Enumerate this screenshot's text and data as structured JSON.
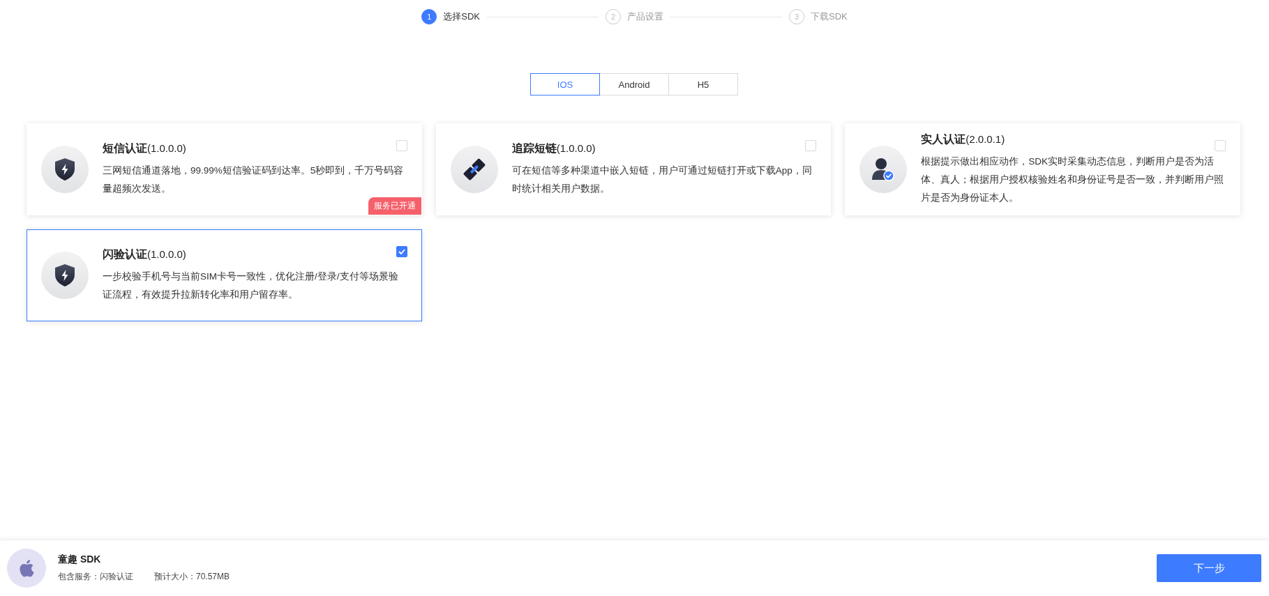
{
  "steps": [
    {
      "number": "1",
      "label": "选择SDK",
      "selected": true
    },
    {
      "number": "2",
      "label": "产品设置",
      "selected": false
    },
    {
      "number": "3",
      "label": "下载SDK",
      "selected": false
    }
  ],
  "platform_tabs": [
    {
      "label": "IOS",
      "selected": true
    },
    {
      "label": "Android",
      "selected": false
    },
    {
      "label": "H5",
      "selected": false
    }
  ],
  "cards": [
    {
      "kind": "shield",
      "title": "**短信认证**(1.0.0.0)",
      "description": "三网短信通道落地，99.99%短信验证码到达率。5秒即到，千万号码容量超频次发送。",
      "checked": false,
      "badge": "服务已开通"
    },
    {
      "kind": "link",
      "title": "**追踪短链**(1.0.0.0)",
      "description": "可在短信等多种渠道中嵌入短链，用户可通过短链打开或下载App，同时统计相关用户数据。",
      "checked": false
    },
    {
      "kind": "person",
      "title": "**实人认证**(2.0.0.1)",
      "description": "根据提示做出相应动作，SDK实时采集动态信息，判断用户是否为活体、真人；根据用户授权核验姓名和身份证号是否一致，并判断用户照片是否为身份证本人。",
      "checked": false
    },
    {
      "kind": "shield",
      "title": "**闪验认证**(1.0.0.0)",
      "description": "一步校验手机号与当前SIM卡号一致性，优化注册/登录/支付等场景验证流程，有效提升拉新转化率和用户留存率。",
      "checked": true
    }
  ],
  "footer": {
    "title": "童趣 SDK",
    "services": "包含服务：闪验认证",
    "size": "预计大小：70.57MB",
    "next_button": "下一步"
  }
}
